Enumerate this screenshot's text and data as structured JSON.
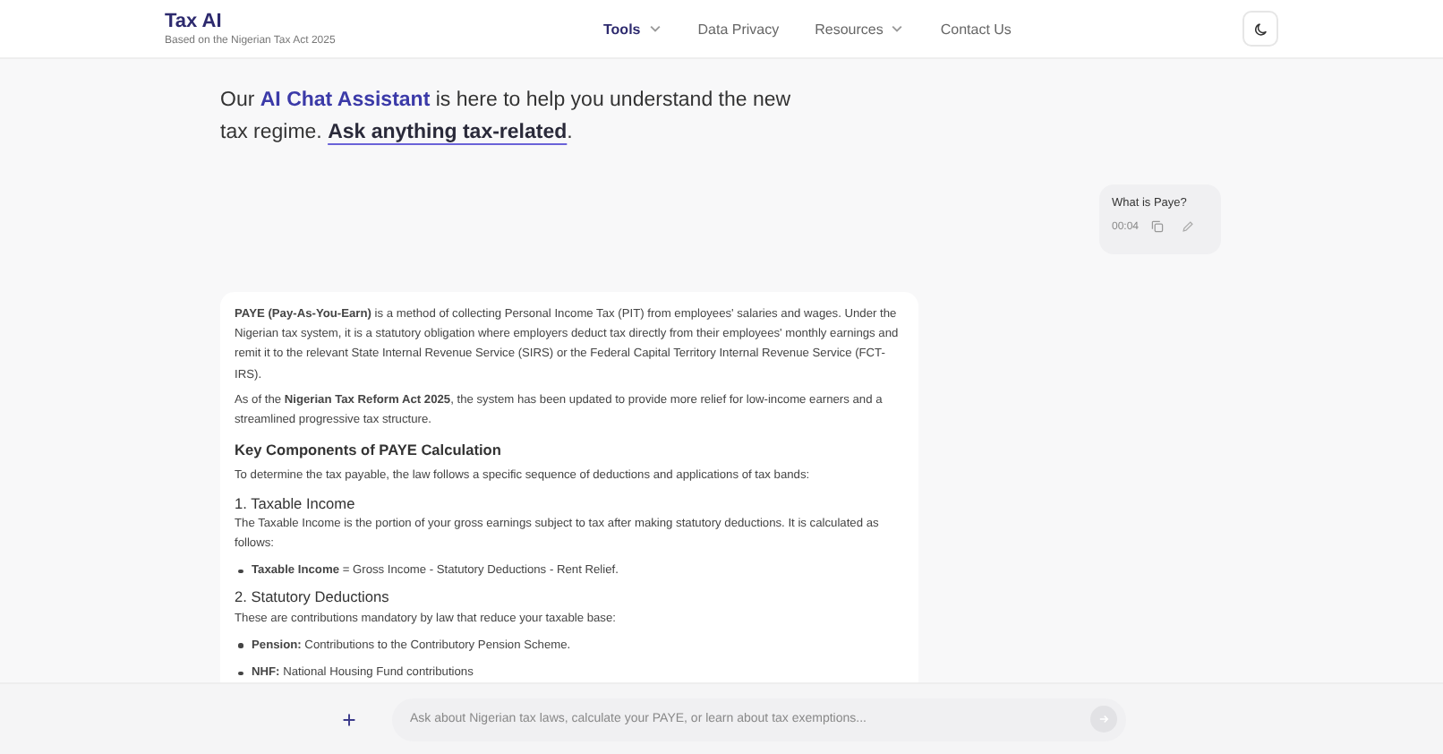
{
  "header": {
    "title": "Tax AI",
    "subtitle": "Based on the Nigerian Tax Act 2025",
    "nav": [
      {
        "label": "Tools",
        "selected": true,
        "has_menu": true
      },
      {
        "label": "Data Privacy",
        "selected": false,
        "has_menu": false
      },
      {
        "label": "Resources",
        "selected": false,
        "has_menu": true
      },
      {
        "label": "Contact Us",
        "selected": false,
        "has_menu": false
      }
    ]
  },
  "intro": [
    {
      "kind": "plain",
      "text": "Our "
    },
    {
      "kind": "highlight",
      "text": "AI Chat Assistant"
    },
    {
      "kind": "plain",
      "text": " is here to help you understand the new tax regime. "
    },
    {
      "kind": "link",
      "text": "Ask anything tax-related"
    },
    {
      "kind": "plain",
      "text": "."
    }
  ],
  "user_message": {
    "text": "What is Paye?",
    "time": "00:04"
  },
  "answer": [
    {
      "kind": "paragraph",
      "text": "**PAYE (Pay-As-You-Earn)** is a method of collecting Personal Income Tax (PIT) from employees' salaries and wages. Under the Nigerian tax system, it is a statutory obligation where employers deduct tax directly from their employees' monthly earnings and remit it to the relevant State Internal Revenue Service (SIRS) or the Federal Capital Territory Internal Revenue Service (FCT-IRS)."
    },
    {
      "kind": "paragraph",
      "text": "As of the **Nigerian Tax Reform Act 2025**, the system has been updated to provide more relief for low-income earners and a streamlined progressive tax structure."
    },
    {
      "kind": "heading",
      "text": "Key Components of PAYE Calculation"
    },
    {
      "kind": "paragraph",
      "text": "To determine the tax payable, the law follows a specific sequence of deductions and applications of tax bands:"
    },
    {
      "kind": "subheading",
      "text": "1. Taxable Income"
    },
    {
      "kind": "paragraph",
      "text": "The Taxable Income is the portion of your gross earnings subject to tax after making statutory deductions. It is calculated as follows:"
    },
    {
      "kind": "bullet",
      "text": "**Taxable Income** = Gross Income - Statutory Deductions - Rent Relief."
    },
    {
      "kind": "subheading",
      "text": "2. Statutory Deductions"
    },
    {
      "kind": "paragraph",
      "text": "These are contributions mandatory by law that reduce your taxable base:"
    },
    {
      "kind": "bullet",
      "text": "**Pension:** Contributions to the Contributory Pension Scheme."
    },
    {
      "kind": "bullet",
      "text": "**NHF:** National Housing Fund contributions"
    }
  ],
  "composer": {
    "placeholder": "Ask about Nigerian tax laws, calculate your PAYE, or learn about tax exemptions..."
  }
}
